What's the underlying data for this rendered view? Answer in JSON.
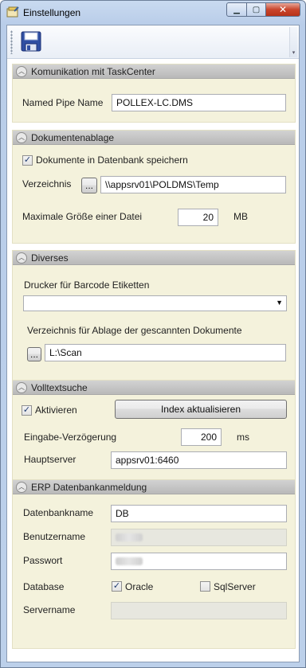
{
  "window": {
    "title": "Einstellungen",
    "minimize_glyph": "▁",
    "maximize_glyph": "▢",
    "close_glyph": "✕"
  },
  "toolbar": {
    "save_icon": "floppy-disk-icon",
    "overflow_glyph": "▾"
  },
  "sections": {
    "taskcenter": {
      "title": "Komunikation mit TaskCenter",
      "named_pipe_label": "Named Pipe Name",
      "named_pipe_value": "POLLEX-LC.DMS"
    },
    "ablage": {
      "title": "Dokumentenablage",
      "store_in_db_label": "Dokumente in Datenbank speichern",
      "store_in_db_checked": true,
      "dir_label": "Verzeichnis",
      "browse_label": "...",
      "dir_value": "\\\\appsrv01\\POLDMS\\Temp",
      "max_size_label": "Maximale Größe einer Datei",
      "max_size_value": "20",
      "max_size_unit": "MB"
    },
    "diverses": {
      "title": "Diverses",
      "printer_label": "Drucker für Barcode Etiketten",
      "printer_value": "",
      "scan_dir_label": "Verzeichnis für Ablage der gescannten Dokumente",
      "browse_label": "...",
      "scan_dir_value": "L:\\Scan"
    },
    "volltext": {
      "title": "Volltextsuche",
      "activate_label": "Aktivieren",
      "activate_checked": true,
      "update_index_label": "Index aktualisieren",
      "delay_label": "Eingabe-Verzögerung",
      "delay_value": "200",
      "delay_unit": "ms",
      "main_server_label": "Hauptserver",
      "main_server_value": "appsrv01:6460"
    },
    "erp": {
      "title": "ERP Datenbankanmeldung",
      "db_name_label": "Datenbankname",
      "db_name_value": "DB",
      "username_label": "Benutzername",
      "password_label": "Passwort",
      "database_label": "Database",
      "oracle_label": "Oracle",
      "oracle_checked": true,
      "sqlserver_label": "SqlServer",
      "sqlserver_checked": false,
      "servername_label": "Servername"
    }
  },
  "colors": {
    "section_bg": "#f4f2dc",
    "header_bg": "#c4c4c4",
    "window_frame": "#bcd0ea"
  }
}
